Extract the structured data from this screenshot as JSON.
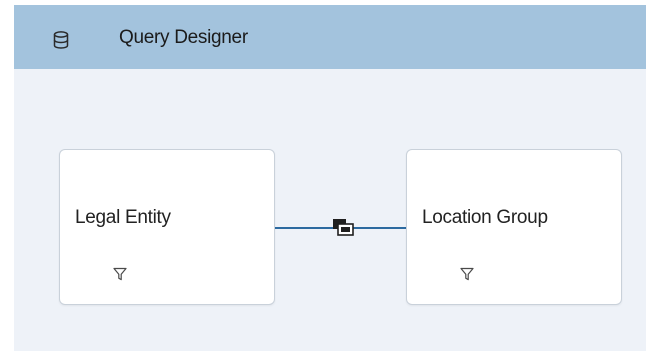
{
  "header": {
    "title": "Query Designer",
    "icon": "database-icon",
    "background": "#a3c3dd"
  },
  "nodes": [
    {
      "label": "Legal Entity",
      "icon": "filter-icon"
    },
    {
      "label": "Location Group",
      "icon": "filter-icon"
    }
  ],
  "connector": {
    "icon": "join-icon",
    "color": "#2c6aa0"
  }
}
